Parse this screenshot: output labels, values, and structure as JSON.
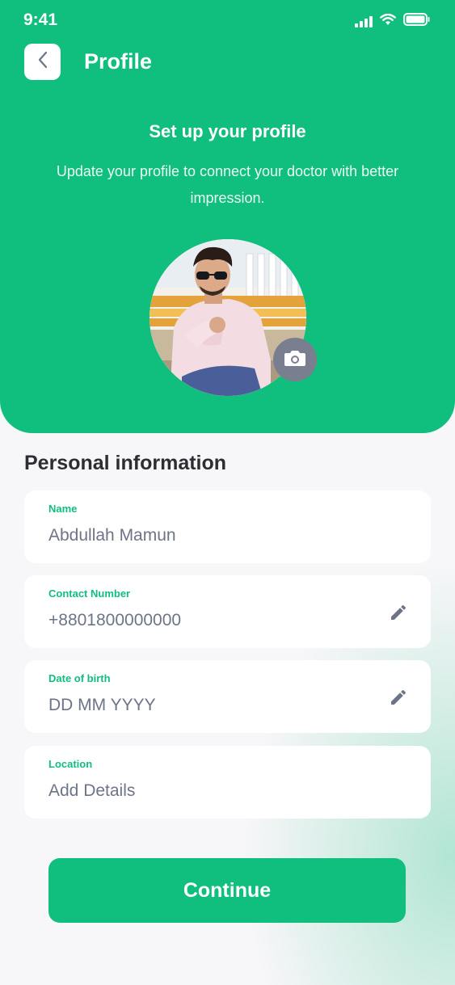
{
  "status_bar": {
    "time": "9:41",
    "icons": [
      "signal-icon",
      "wifi-icon",
      "battery-icon"
    ]
  },
  "header": {
    "back_icon": "chevron-left-icon",
    "title": "Profile",
    "heading": "Set up your profile",
    "subtitle": "Update your profile to connect your doctor with better impression."
  },
  "avatar": {
    "camera_icon": "camera-icon"
  },
  "personal_info": {
    "title": "Personal information",
    "fields": [
      {
        "label": "Name",
        "value": "Abdullah Mamun",
        "editable_icon": null
      },
      {
        "label": "Contact Number",
        "value": "+8801800000000",
        "editable_icon": "pencil-icon"
      },
      {
        "label": "Date of birth",
        "value": "DD MM YYYY",
        "editable_icon": "pencil-icon"
      },
      {
        "label": "Location",
        "value": "Add Details",
        "editable_icon": null
      }
    ]
  },
  "actions": {
    "continue_label": "Continue"
  },
  "colors": {
    "primary": "#10be7e",
    "background": "#f7f6f8",
    "text_dark": "#2d2d33",
    "text_muted": "#6e7488"
  }
}
